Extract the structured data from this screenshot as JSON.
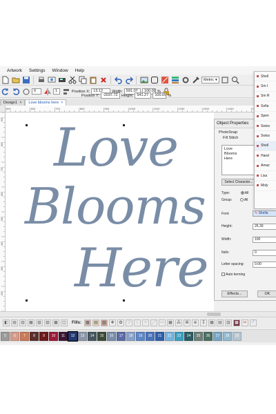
{
  "menu": [
    "Artwork",
    "Settings",
    "Window",
    "Help"
  ],
  "toolbar": {
    "position_x_label": "Position X:",
    "position_x_value": "13.12",
    "position_y_label": "Position Y:",
    "position_y_value": "-2037.72",
    "width_label": "Width:",
    "width_value": "591.07",
    "height_label": "Height:",
    "height_value": "541.27",
    "width_pct": "100.09",
    "height_pct": "100.09",
    "pct_symbol": "%",
    "units_value": "Metric",
    "rotate_value": "0",
    "step_value": "1"
  },
  "tabs": [
    {
      "label": "Design1"
    },
    {
      "label": "Love blooms here"
    }
  ],
  "ruler_h_ticks": [
    "500",
    "600",
    "700",
    "800",
    "900",
    "1000",
    "1100",
    "1200",
    "1300",
    "1400",
    "1500"
  ],
  "ruler_v_ticks": [
    "-900",
    "-800",
    "-700",
    "-600",
    "-500",
    "-400",
    "-300",
    "-200"
  ],
  "design": {
    "line1": "Love",
    "line2": "Blooms",
    "line3": "Here",
    "thread_color": "#7a8da6"
  },
  "fills": {
    "label": "Fills:"
  },
  "palette": [
    {
      "num": "5",
      "color": "#9a9a9a"
    },
    {
      "num": "6",
      "color": "#d59a8a"
    },
    {
      "num": "7",
      "color": "#c97a5a"
    },
    {
      "num": "8",
      "color": "#5b2e2e"
    },
    {
      "num": "9",
      "color": "#6b1b1b"
    },
    {
      "num": "10",
      "color": "#9b1a3a"
    },
    {
      "num": "11",
      "color": "#3d1733"
    },
    {
      "num": "12",
      "color": "#253a72"
    },
    {
      "num": "13",
      "color": "#8d97a8"
    },
    {
      "num": "14",
      "color": "#47565e"
    },
    {
      "num": "15",
      "color": "#3c4a3a"
    },
    {
      "num": "16",
      "color": "#7b8ea9"
    },
    {
      "num": "17",
      "color": "#5b6ba6"
    },
    {
      "num": "18",
      "color": "#8aa1c8"
    },
    {
      "num": "19",
      "color": "#5d87c5"
    },
    {
      "num": "20",
      "color": "#4b74b8"
    },
    {
      "num": "21",
      "color": "#2f5fa8"
    },
    {
      "num": "22",
      "color": "#78b3e0"
    },
    {
      "num": "23",
      "color": "#3d9fbf"
    },
    {
      "num": "24",
      "color": "#2a5d66"
    },
    {
      "num": "25",
      "color": "#6e7f7a"
    },
    {
      "num": "26",
      "color": "#4d6f63"
    },
    {
      "num": "27",
      "color": "#7aa5c4"
    },
    {
      "num": "28",
      "color": "#94b9cf"
    },
    {
      "num": "29",
      "color": "#b7c6d0"
    }
  ],
  "selected_palette": "12",
  "props": {
    "title": "Object Properties",
    "tab_photosnap": "PhotoSnap",
    "tab_fill": "Fill Stitch",
    "text": [
      "Love",
      "Blooms",
      "Here"
    ],
    "select_char": "Select Character...",
    "type_label": "Type:",
    "type_value": "All",
    "group_label": "Group:",
    "group_value": "All",
    "font_label": "Font:",
    "font_value": "Shella",
    "height_label": "Height:",
    "height_value": "26.30",
    "width_label": "Width:",
    "width_value": "100",
    "italic_label": "Italic:",
    "italic_value": "0",
    "spacing_label": "Letter spacing:",
    "spacing_value": "0.00",
    "auto_kerning": "Auto kerning",
    "effects_btn": "Effects...",
    "ok_btn": "OK"
  },
  "fontlist": [
    "Shell",
    "Sm I",
    "Sm R",
    "Sofia",
    "Spen",
    "Swiss",
    "Swiss",
    "Shell",
    "Hand",
    "Amaz",
    "Lisa",
    "Moly"
  ]
}
